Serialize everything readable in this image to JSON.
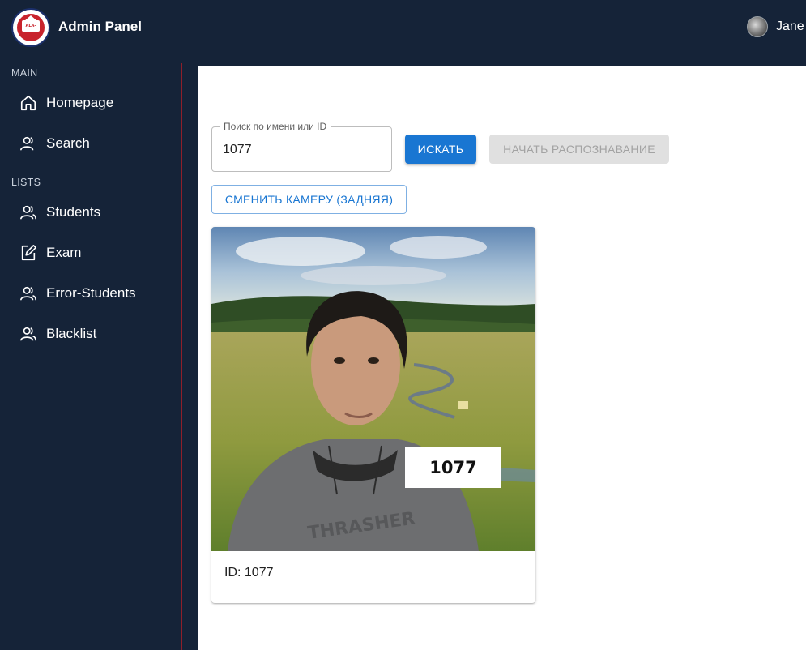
{
  "header": {
    "app_title": "Admin Panel",
    "user_name": "Jane"
  },
  "sidebar": {
    "sections": [
      {
        "label": "MAIN"
      },
      {
        "label": "LISTS"
      }
    ],
    "items": [
      {
        "label": "Homepage",
        "icon": "home-icon"
      },
      {
        "label": "Search",
        "icon": "person-icon"
      },
      {
        "label": "Students",
        "icon": "people-icon"
      },
      {
        "label": "Exam",
        "icon": "edit-icon"
      },
      {
        "label": "Error-Students",
        "icon": "people-icon"
      },
      {
        "label": "Blacklist",
        "icon": "people-icon"
      }
    ]
  },
  "search": {
    "label": "Поиск по имени или ID",
    "value": "1077",
    "search_button": "ИСКАТЬ",
    "recognize_button": "НАЧАТЬ РАСПОЗНАВАНИЕ",
    "camera_button": "СМЕНИТЬ КАМЕРУ (ЗАДНЯЯ)"
  },
  "result_card": {
    "overlay_id": "1077",
    "caption": "ID: 1077"
  },
  "colors": {
    "sidebar_bg": "#152338",
    "accent": "#1976d2",
    "divider": "#8e1f2a"
  }
}
